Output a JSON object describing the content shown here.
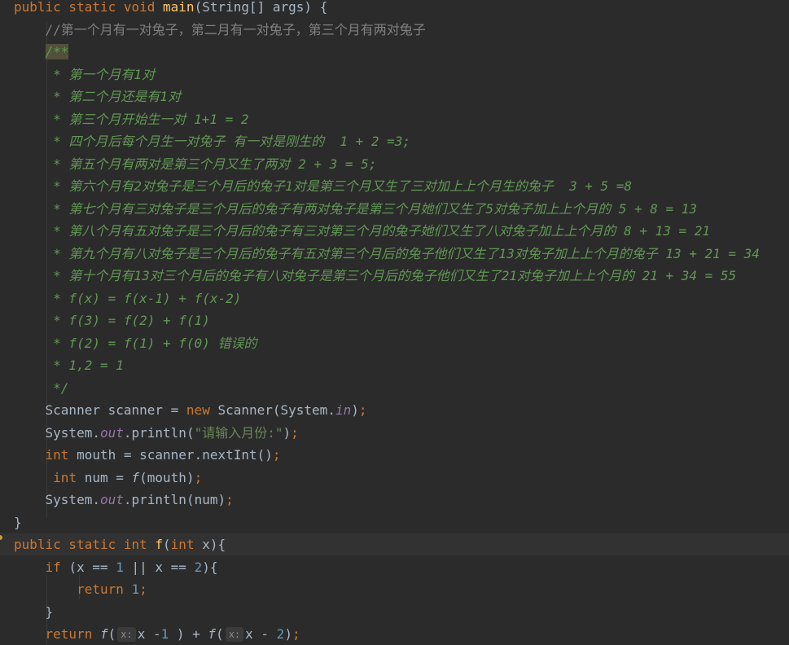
{
  "editor": {
    "colors": {
      "background": "#2b2b2b",
      "current_line": "#323232",
      "keyword": "#cc7832",
      "text": "#a9b7c6",
      "number": "#6897bb",
      "string": "#6a8759",
      "method_declaration": "#ffc66d",
      "static_field": "#9876aa",
      "doc_comment": "#629755",
      "line_comment": "#808080",
      "inlay_hint_bg": "#3b3b3b",
      "gutter_marker": "#c9a034"
    },
    "lines": [
      {
        "tokens": [
          {
            "t": "public static void ",
            "c": "kw"
          },
          {
            "t": "main",
            "c": "fn"
          },
          {
            "t": "(String[] args) {",
            "c": "txt"
          }
        ]
      },
      {
        "tokens": [
          {
            "t": "    ",
            "c": "txt"
          },
          {
            "t": "//第一个月有一对兔子，第二月有一对兔子，第三个月有两对兔子",
            "c": "lc"
          }
        ]
      },
      {
        "tokens": [
          {
            "t": "    ",
            "c": "txt"
          },
          {
            "t": "/**",
            "c": "doc-hl"
          }
        ]
      },
      {
        "tokens": [
          {
            "t": "     * 第一个月有1对",
            "c": "doc"
          }
        ]
      },
      {
        "tokens": [
          {
            "t": "     * 第二个月还是有1对",
            "c": "doc"
          }
        ]
      },
      {
        "tokens": [
          {
            "t": "     * 第三个月开始生一对 1+1 = 2",
            "c": "doc"
          }
        ]
      },
      {
        "tokens": [
          {
            "t": "     * 四个月后每个月生一对兔子 有一对是刚生的  1 + 2 =3;",
            "c": "doc"
          }
        ]
      },
      {
        "tokens": [
          {
            "t": "     * 第五个月有两对是第三个月又生了两对 2 + 3 = 5;",
            "c": "doc"
          }
        ]
      },
      {
        "tokens": [
          {
            "t": "     * 第六个月有2对兔子是三个月后的兔子1对是第三个月又生了三对加上上个月生的兔子  3 + 5 =8",
            "c": "doc"
          }
        ]
      },
      {
        "tokens": [
          {
            "t": "     * 第七个月有三对兔子是三个月后的兔子有两对兔子是第三个月她们又生了5对兔子加上上个月的 5 + 8 = 13",
            "c": "doc"
          }
        ]
      },
      {
        "tokens": [
          {
            "t": "     * 第八个月有五对兔子是三个月后的兔子有三对第三个月的兔子她们又生了八对兔子加上上个月的 8 + 13 = 21",
            "c": "doc"
          }
        ]
      },
      {
        "tokens": [
          {
            "t": "     * 第九个月有八对兔子是三个月后的兔子有五对第三个月后的兔子他们又生了13对兔子加上上个月的兔子 13 + 21 = 34",
            "c": "doc"
          }
        ]
      },
      {
        "tokens": [
          {
            "t": "     * 第十个月有13对三个月后的兔子有八对兔子是第三个月后的兔子他们又生了21对兔子加上上个月的 21 + 34 = 55",
            "c": "doc"
          }
        ]
      },
      {
        "tokens": [
          {
            "t": "     * f(x) = f(x-1) + f(x-2)",
            "c": "doc"
          }
        ]
      },
      {
        "tokens": [
          {
            "t": "     * f(3) = f(2) + f(1)",
            "c": "doc"
          }
        ]
      },
      {
        "tokens": [
          {
            "t": "     * f(2) = f(1) + f(0) 错误的",
            "c": "doc"
          }
        ]
      },
      {
        "tokens": [
          {
            "t": "     * 1,2 = 1",
            "c": "doc"
          }
        ]
      },
      {
        "tokens": [
          {
            "t": "     */",
            "c": "doc"
          }
        ]
      },
      {
        "tokens": [
          {
            "t": "    Scanner scanner = ",
            "c": "txt"
          },
          {
            "t": "new ",
            "c": "kw"
          },
          {
            "t": "Scanner(System.",
            "c": "txt"
          },
          {
            "t": "in",
            "c": "field"
          },
          {
            "t": ")",
            "c": "txt"
          },
          {
            "t": ";",
            "c": "kw"
          }
        ]
      },
      {
        "tokens": [
          {
            "t": "    System.",
            "c": "txt"
          },
          {
            "t": "out",
            "c": "field"
          },
          {
            "t": ".println(",
            "c": "txt"
          },
          {
            "t": "\"请输入月份:\"",
            "c": "str"
          },
          {
            "t": ")",
            "c": "txt"
          },
          {
            "t": ";",
            "c": "kw"
          }
        ]
      },
      {
        "tokens": [
          {
            "t": "    ",
            "c": "txt"
          },
          {
            "t": "int ",
            "c": "kw"
          },
          {
            "t": "mouth = scanner.nextInt()",
            "c": "txt"
          },
          {
            "t": ";",
            "c": "kw"
          }
        ]
      },
      {
        "tokens": [
          {
            "t": "     ",
            "c": "txt"
          },
          {
            "t": "int ",
            "c": "kw"
          },
          {
            "t": "num = ",
            "c": "txt"
          },
          {
            "t": "f",
            "c": "static"
          },
          {
            "t": "(mouth)",
            "c": "txt"
          },
          {
            "t": ";",
            "c": "kw"
          }
        ]
      },
      {
        "tokens": [
          {
            "t": "    System.",
            "c": "txt"
          },
          {
            "t": "out",
            "c": "field"
          },
          {
            "t": ".println(num)",
            "c": "txt"
          },
          {
            "t": ";",
            "c": "kw"
          }
        ]
      },
      {
        "tokens": [
          {
            "t": "}",
            "c": "txt"
          }
        ]
      },
      {
        "current": true,
        "marker": true,
        "tokens": [
          {
            "t": "public static int ",
            "c": "kw"
          },
          {
            "t": "f",
            "c": "fn"
          },
          {
            "t": "(",
            "c": "txt"
          },
          {
            "t": "int ",
            "c": "kw"
          },
          {
            "t": "x){",
            "c": "txt"
          }
        ]
      },
      {
        "tokens": [
          {
            "t": "    ",
            "c": "txt"
          },
          {
            "t": "if ",
            "c": "kw"
          },
          {
            "t": "(x == ",
            "c": "txt"
          },
          {
            "t": "1 ",
            "c": "num"
          },
          {
            "t": "|| x == ",
            "c": "txt"
          },
          {
            "t": "2",
            "c": "num"
          },
          {
            "t": "){",
            "c": "txt"
          }
        ]
      },
      {
        "tokens": [
          {
            "t": "        ",
            "c": "txt"
          },
          {
            "t": "return ",
            "c": "kw"
          },
          {
            "t": "1",
            "c": "num"
          },
          {
            "t": ";",
            "c": "kw"
          }
        ]
      },
      {
        "tokens": [
          {
            "t": "    }",
            "c": "txt"
          }
        ]
      },
      {
        "tokens": [
          {
            "t": "    ",
            "c": "txt"
          },
          {
            "t": "return ",
            "c": "kw"
          },
          {
            "t": "f",
            "c": "static"
          },
          {
            "t": "(",
            "c": "txt"
          },
          {
            "t": "x:",
            "c": "hint"
          },
          {
            "t": "x -",
            "c": "txt"
          },
          {
            "t": "1 ",
            "c": "num"
          },
          {
            "t": ") + ",
            "c": "txt"
          },
          {
            "t": "f",
            "c": "static"
          },
          {
            "t": "(",
            "c": "txt"
          },
          {
            "t": "x:",
            "c": "hint"
          },
          {
            "t": "x - ",
            "c": "txt"
          },
          {
            "t": "2",
            "c": "num"
          },
          {
            "t": ")",
            "c": "txt"
          },
          {
            "t": ";",
            "c": "kw"
          }
        ]
      }
    ]
  }
}
